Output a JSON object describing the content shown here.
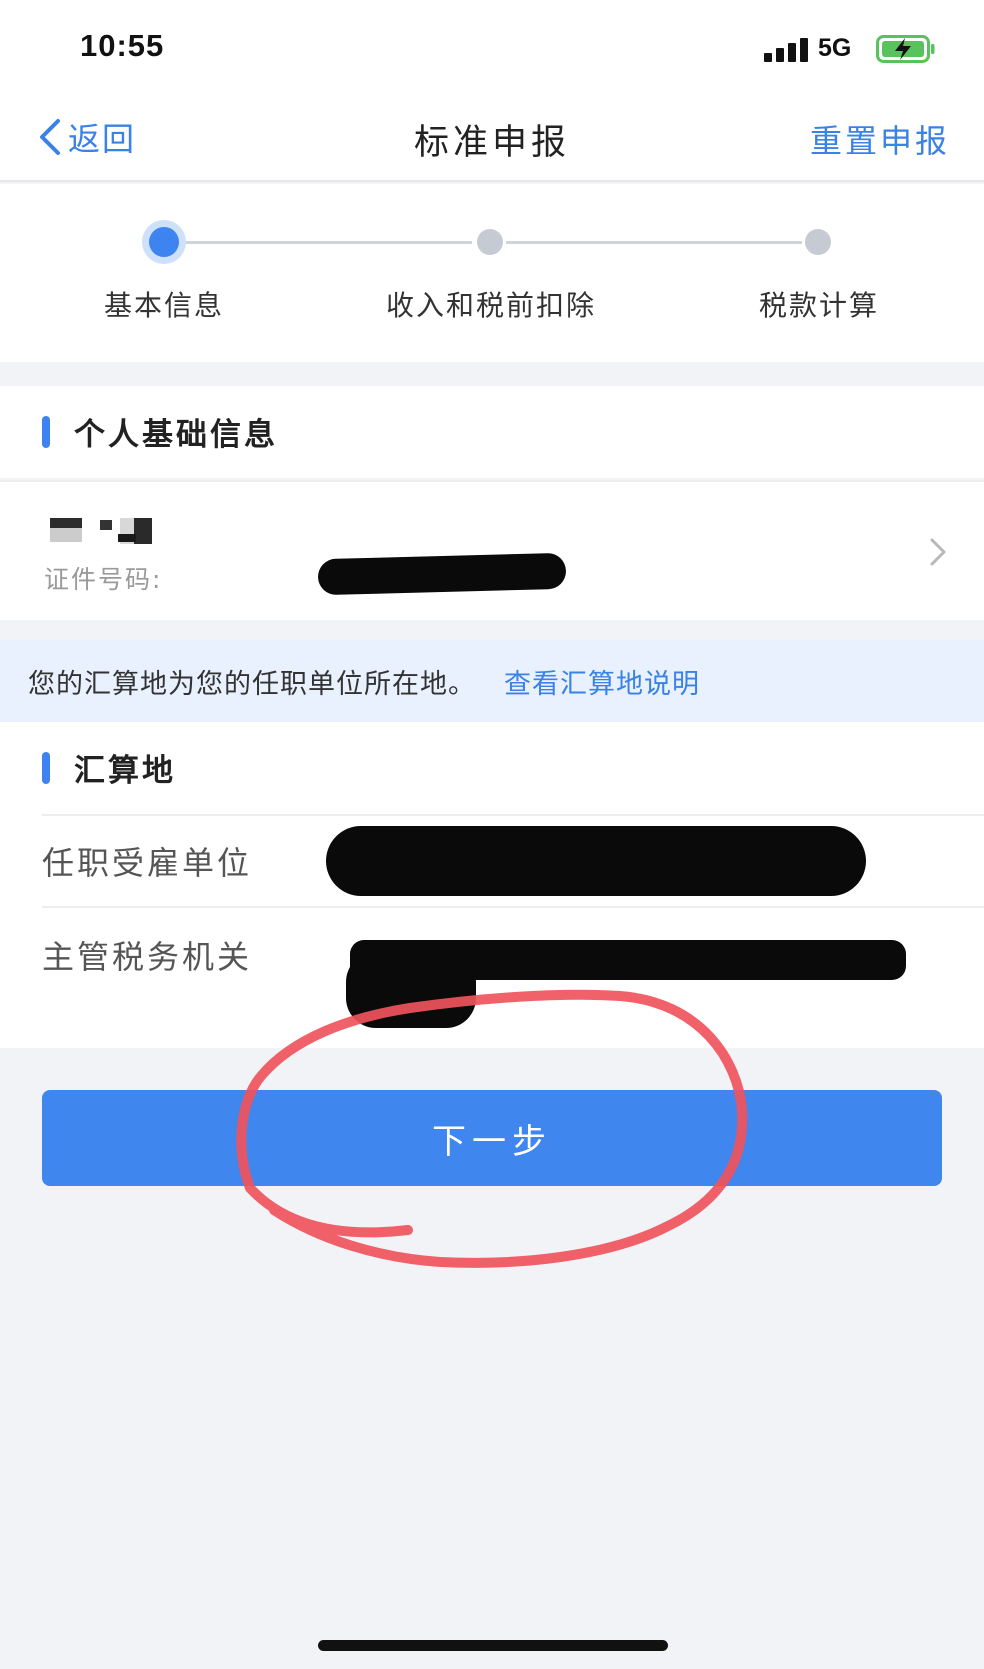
{
  "status_bar": {
    "time": "10:55",
    "network": "5G"
  },
  "nav": {
    "back_label": "返回",
    "title": "标准申报",
    "reset_label": "重置申报"
  },
  "steps": [
    {
      "label": "基本信息",
      "active": true
    },
    {
      "label": "收入和税前扣除",
      "active": false
    },
    {
      "label": "税款计算",
      "active": false
    }
  ],
  "personal": {
    "section_title": "个人基础信息",
    "id_label": "证件号码:"
  },
  "notice": {
    "text": "您的汇算地为您的任职单位所在地。",
    "link": "查看汇算地说明"
  },
  "settlement": {
    "section_title": "汇算地",
    "employer_label": "任职受雇单位",
    "tax_authority_label": "主管税务机关"
  },
  "actions": {
    "next_label": "下一步"
  },
  "colors": {
    "accent": "#3d84f0",
    "link": "#3a82e6",
    "annotation": "#f0545c"
  }
}
